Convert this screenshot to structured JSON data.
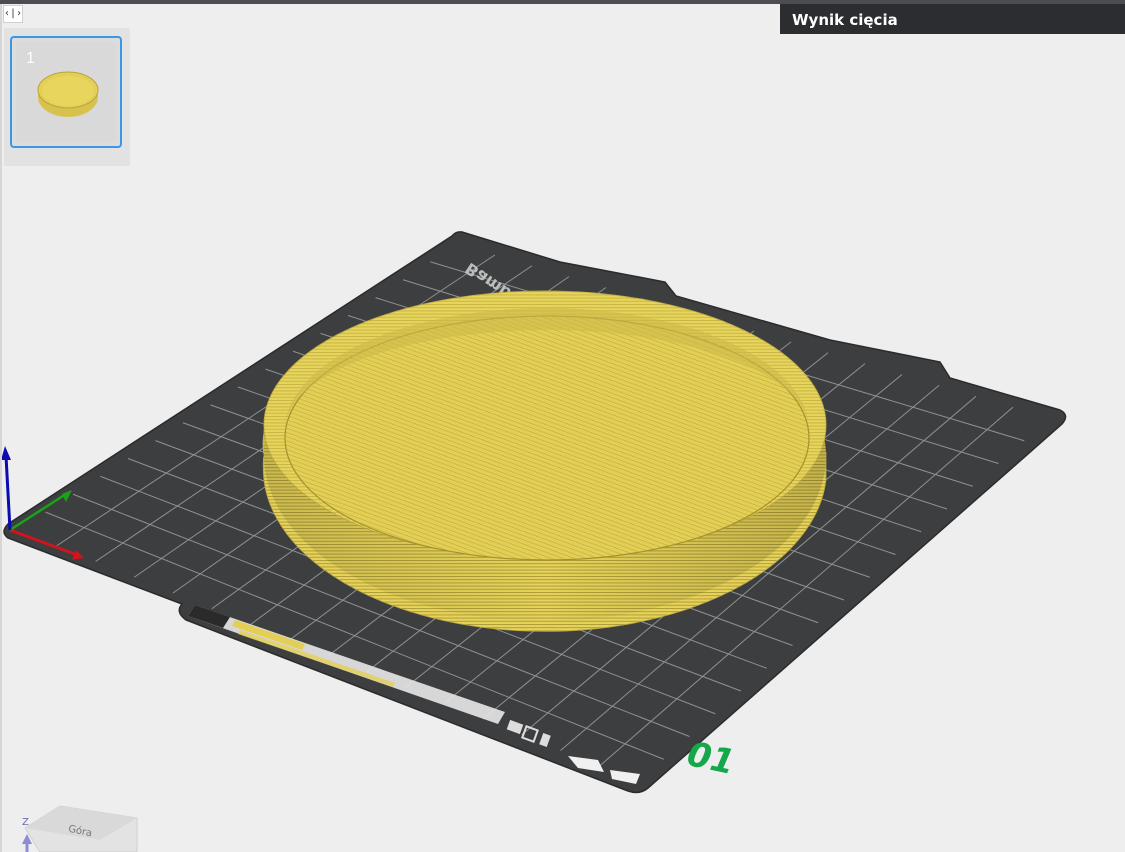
{
  "header": {
    "collapse_label": "‹|›",
    "result_tab_label": "Wynik cięcia"
  },
  "plates": [
    {
      "number": "1",
      "selected": true
    }
  ],
  "bed": {
    "brand_text": "Bambu Textured PEI",
    "plate_badge": "01",
    "badge_color": "#15a84a",
    "surface_color": "#3d3e3f",
    "grid_color": "#9a9a9a"
  },
  "model": {
    "shape": "cylindrical tray",
    "filament_color": "#e3cf55"
  },
  "axes": {
    "x_color": "#d0131c",
    "y_color": "#1aa21a",
    "z_color": "#0b0bb0"
  },
  "view_cube": {
    "face_label": "Góra",
    "axis_label": "Z"
  },
  "colors": {
    "background": "#eeeeee",
    "selection": "#3b96e6",
    "tab_background": "#2b2d31"
  }
}
